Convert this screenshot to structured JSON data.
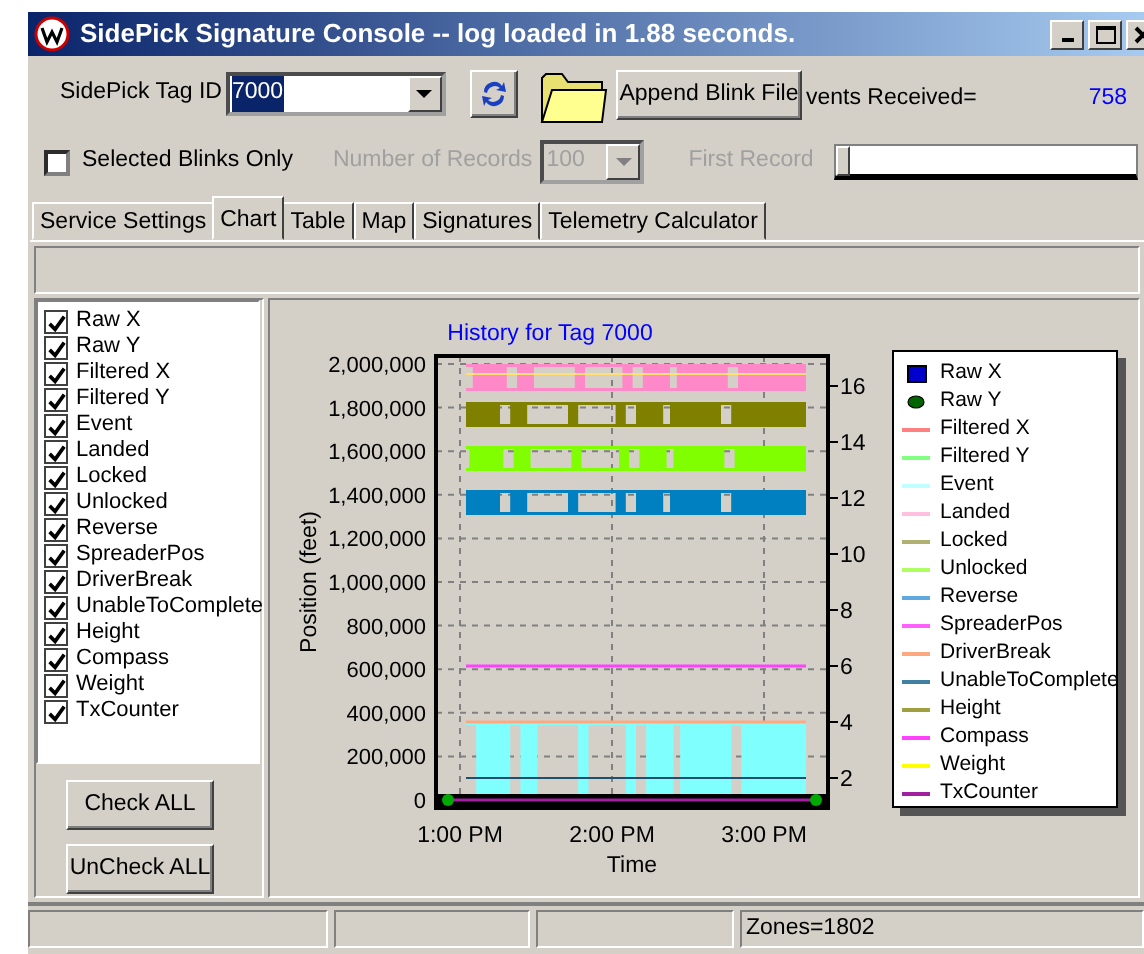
{
  "window": {
    "title": "SidePick Signature Console -- log loaded in 1.88 seconds."
  },
  "toolbar": {
    "tag_label": "SidePick Tag ID",
    "tag_value": "7000",
    "tag_value_selected": true,
    "append_button": "Append Blink File",
    "events_label": "vents Received=",
    "events_count": "758"
  },
  "filters": {
    "selected_only": {
      "label": "Selected Blinks Only",
      "checked": false
    },
    "records_label": "Number of Records",
    "records_value": "100",
    "disabled": true,
    "first_record_label": "First Record",
    "first_record_slider": {
      "level": 0
    }
  },
  "tabs": [
    {
      "label": "Service Settings",
      "selected": false
    },
    {
      "label": "Chart",
      "selected": true
    },
    {
      "label": "Table",
      "selected": false
    },
    {
      "label": "Map",
      "selected": false
    },
    {
      "label": "Signatures",
      "selected": false
    },
    {
      "label": "Telemetry Calculator",
      "selected": false
    }
  ],
  "series_list": [
    {
      "label": "Raw X",
      "checked": true
    },
    {
      "label": "Raw Y",
      "checked": true
    },
    {
      "label": "Filtered X",
      "checked": true
    },
    {
      "label": "Filtered Y",
      "checked": true
    },
    {
      "label": "Event",
      "checked": true
    },
    {
      "label": "Landed",
      "checked": true
    },
    {
      "label": "Locked",
      "checked": true
    },
    {
      "label": "Unlocked",
      "checked": true
    },
    {
      "label": "Reverse",
      "checked": true
    },
    {
      "label": "SpreaderPos",
      "checked": true
    },
    {
      "label": "DriverBreak",
      "checked": true
    },
    {
      "label": "UnableToComplete",
      "checked": true
    },
    {
      "label": "Height",
      "checked": true
    },
    {
      "label": "Compass",
      "checked": true
    },
    {
      "label": "Weight",
      "checked": true
    },
    {
      "label": "TxCounter",
      "checked": true
    }
  ],
  "list_buttons": [
    "Check ALL",
    "UnCheck ALL"
  ],
  "chart": {
    "title": "History for Tag 7000",
    "ylabel": "Position (feet)",
    "xlabel": "Time",
    "yticks": [
      "2,000,000",
      "1,800,000",
      "1,600,000",
      "1,400,000",
      "1,200,000",
      "1,000,000",
      "800,000",
      "600,000",
      "400,000",
      "200,000",
      "0"
    ],
    "y2ticks": [
      "16",
      "14",
      "12",
      "10",
      "8",
      "6",
      "4",
      "2"
    ],
    "xticks": [
      "1:00 PM",
      "2:00 PM",
      "3:00 PM"
    ],
    "legend": [
      {
        "label": "Raw X",
        "color": "#0000cc",
        "kind": "square"
      },
      {
        "label": "Raw Y",
        "color": "#006600",
        "kind": "circle"
      },
      {
        "label": "Filtered X",
        "color": "#ff8080",
        "kind": "line"
      },
      {
        "label": "Filtered Y",
        "color": "#80ff80",
        "kind": "line"
      },
      {
        "label": "Event",
        "color": "#c0ffff",
        "kind": "line"
      },
      {
        "label": "Landed",
        "color": "#ffc0e0",
        "kind": "line"
      },
      {
        "label": "Locked",
        "color": "#b0b070",
        "kind": "line"
      },
      {
        "label": "Unlocked",
        "color": "#b0ff60",
        "kind": "line"
      },
      {
        "label": "Reverse",
        "color": "#60a8e0",
        "kind": "line"
      },
      {
        "label": "SpreaderPos",
        "color": "#ff60ff",
        "kind": "line"
      },
      {
        "label": "DriverBreak",
        "color": "#ffa880",
        "kind": "line"
      },
      {
        "label": "UnableToComplete",
        "color": "#4080a0",
        "kind": "line"
      },
      {
        "label": "Height",
        "color": "#a0a040",
        "kind": "line"
      },
      {
        "label": "Compass",
        "color": "#ff40ff",
        "kind": "line"
      },
      {
        "label": "Weight",
        "color": "#ffff00",
        "kind": "line"
      },
      {
        "label": "TxCounter",
        "color": "#a020a0",
        "kind": "line"
      }
    ]
  },
  "status_bar": {
    "zones": "Zones=1802"
  }
}
